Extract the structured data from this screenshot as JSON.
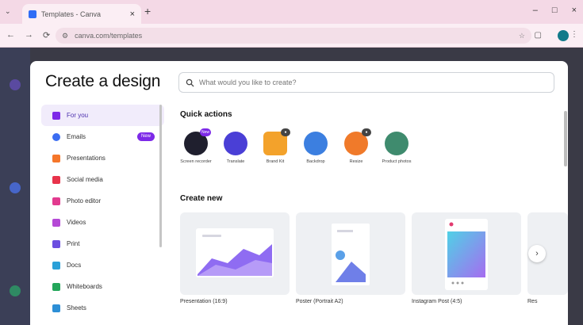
{
  "browser": {
    "tab_title": "Templates - Canva",
    "tab_close": "×",
    "new_tab": "+",
    "url": "canva.com/templates",
    "window_controls": [
      "–",
      "□",
      "×"
    ],
    "nav": [
      "←",
      "→",
      "⟳"
    ]
  },
  "modal": {
    "title": "Create a design",
    "search_placeholder": "What would you like to create?"
  },
  "sidebar": {
    "items": [
      {
        "label": "For you",
        "color": "#7d2ae8",
        "active": true
      },
      {
        "label": "Emails",
        "color": "#3b6df2",
        "badge": "New"
      },
      {
        "label": "Presentations",
        "color": "#f5762a"
      },
      {
        "label": "Social media",
        "color": "#e8334b"
      },
      {
        "label": "Photo editor",
        "color": "#e23a8f"
      },
      {
        "label": "Videos",
        "color": "#b549d6"
      },
      {
        "label": "Print",
        "color": "#6c4fe0"
      },
      {
        "label": "Docs",
        "color": "#2aa0d8"
      },
      {
        "label": "Whiteboards",
        "color": "#23a65a"
      },
      {
        "label": "Sheets",
        "color": "#2d8fd6"
      }
    ]
  },
  "quick_actions": {
    "heading": "Quick actions",
    "items": [
      {
        "label": "Screen recorder",
        "color": "#1f1f2e",
        "badge": "New",
        "badge_color": "#7d2ae8"
      },
      {
        "label": "Translate",
        "color": "#4a3fd6"
      },
      {
        "label": "Brand Kit",
        "color": "#f3a22b",
        "badge": "●",
        "badge_color": "#444"
      },
      {
        "label": "Backdrop",
        "color": "#3c7fe0"
      },
      {
        "label": "Resize",
        "color": "#f07a2a",
        "badge": "●",
        "badge_color": "#444"
      },
      {
        "label": "Product photos",
        "color": "#3f8b6e"
      }
    ]
  },
  "create_new": {
    "heading": "Create new",
    "cards": [
      {
        "label": "Presentation (16:9)"
      },
      {
        "label": "Poster (Portrait A2)"
      },
      {
        "label": "Instagram Post (4:5)"
      },
      {
        "label": "Res"
      }
    ],
    "next": "›"
  }
}
